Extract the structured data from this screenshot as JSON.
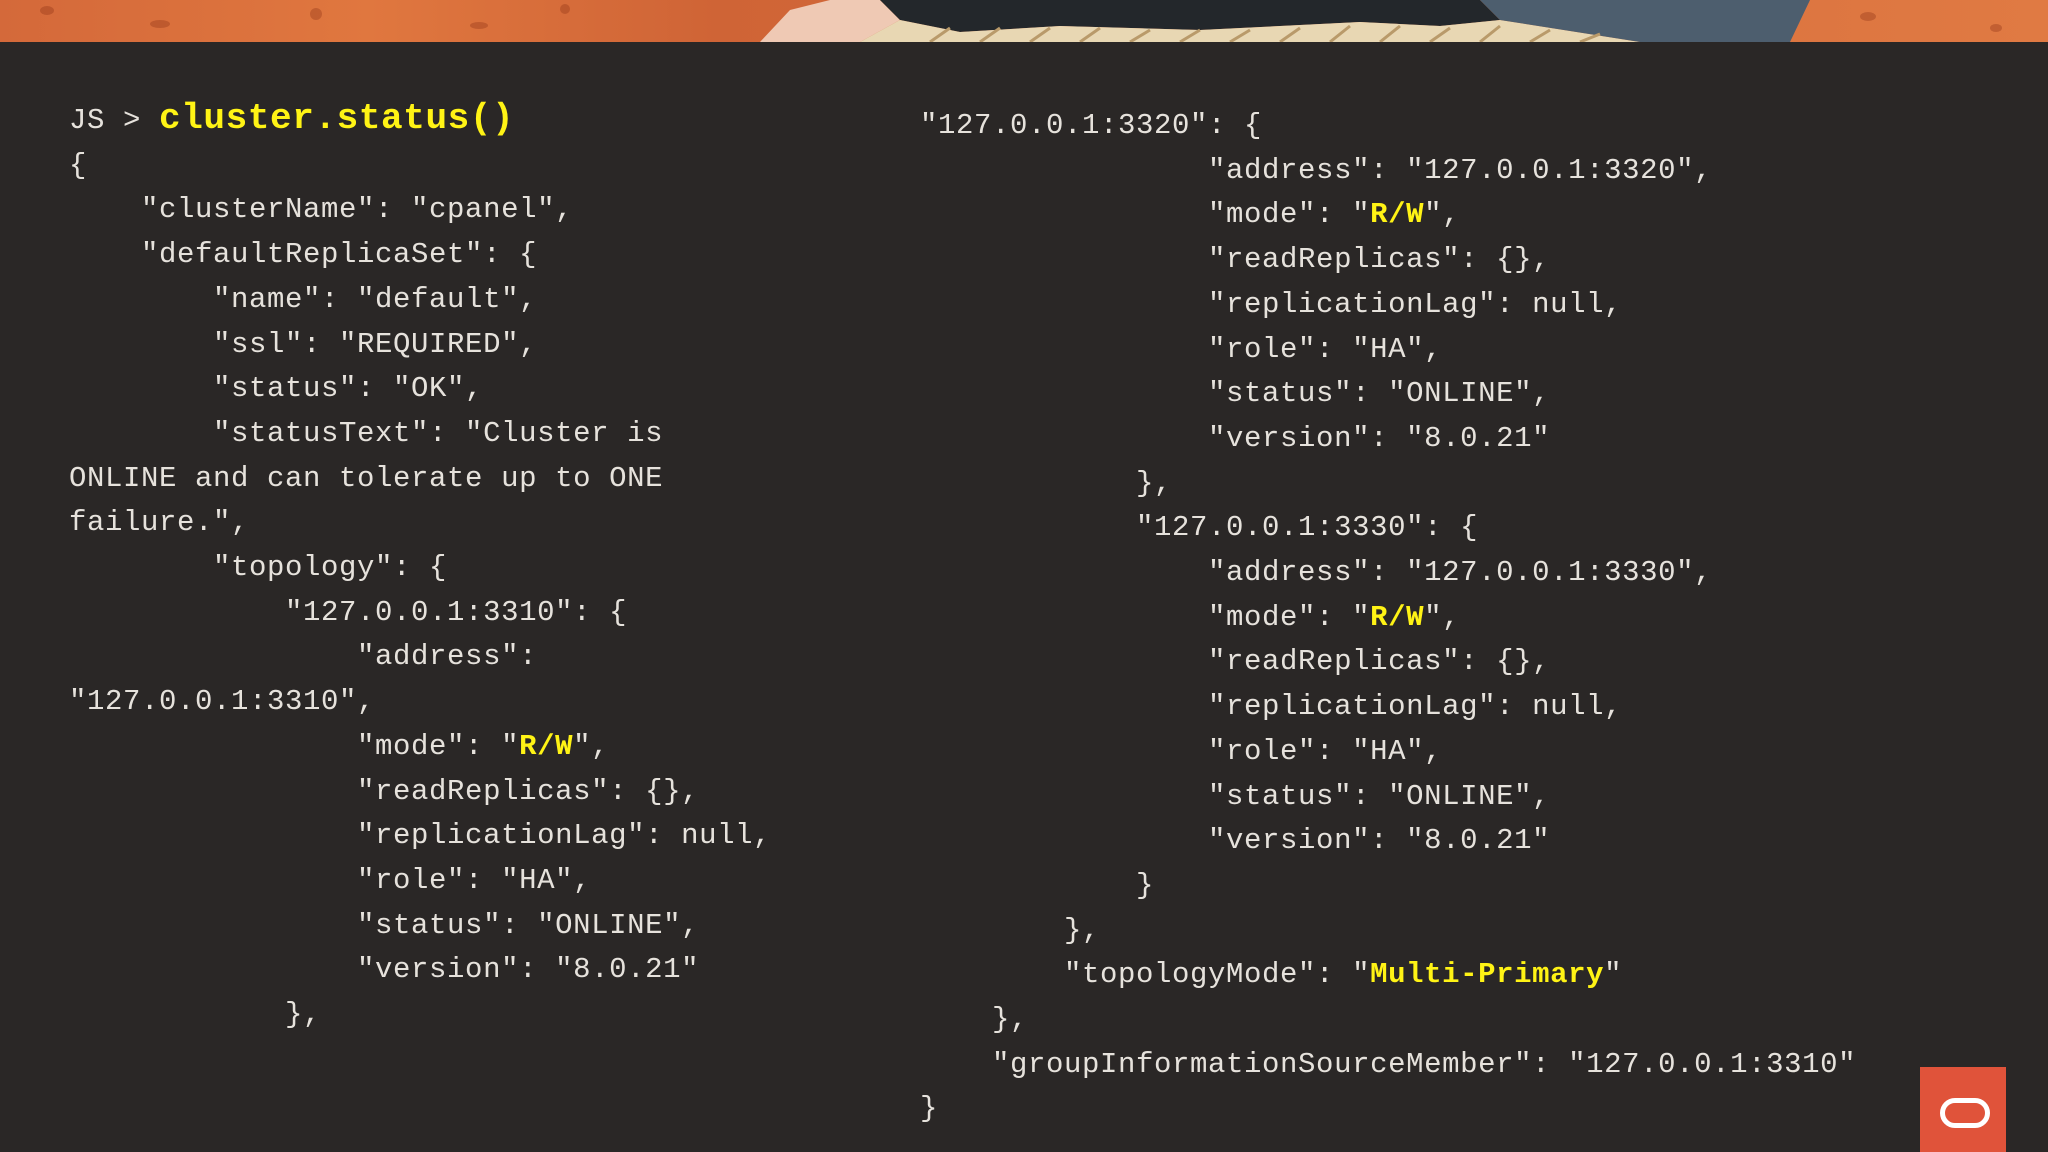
{
  "colors": {
    "background": "#2a2726",
    "code_text": "#e6e2dc",
    "highlight": "#fff315",
    "banner": "#e0773f",
    "badge": "#e0533a"
  },
  "prompt": {
    "prefix": "JS > ",
    "command": "cluster.status()"
  },
  "left_lines": [
    [
      {
        "t": "{"
      }
    ],
    [
      {
        "t": "    \"clusterName\": \"cpanel\","
      }
    ],
    [
      {
        "t": "    \"defaultReplicaSet\": {"
      }
    ],
    [
      {
        "t": "        \"name\": \"default\","
      }
    ],
    [
      {
        "t": "        \"ssl\": \"REQUIRED\","
      }
    ],
    [
      {
        "t": "        \"status\": \"OK\","
      }
    ],
    [
      {
        "t": "        \"statusText\": \"Cluster is"
      }
    ],
    [
      {
        "t": "ONLINE and can tolerate up to ONE"
      }
    ],
    [
      {
        "t": "failure.\","
      }
    ],
    [
      {
        "t": "        \"topology\": {"
      }
    ],
    [
      {
        "t": "            \"127.0.0.1:3310\": {"
      }
    ],
    [
      {
        "t": "                \"address\":"
      }
    ],
    [
      {
        "t": "\"127.0.0.1:3310\","
      }
    ],
    [
      {
        "t": "                \"mode\": \""
      },
      {
        "t": "R/W",
        "hl": true
      },
      {
        "t": "\","
      }
    ],
    [
      {
        "t": "                \"readReplicas\": {},"
      }
    ],
    [
      {
        "t": "                \"replicationLag\": null,"
      }
    ],
    [
      {
        "t": "                \"role\": \"HA\","
      }
    ],
    [
      {
        "t": "                \"status\": \"ONLINE\","
      }
    ],
    [
      {
        "t": "                \"version\": \"8.0.21\""
      }
    ],
    [
      {
        "t": "            },"
      }
    ]
  ],
  "right_lines": [
    [
      {
        "t": "\"127.0.0.1:3320\": {"
      }
    ],
    [
      {
        "t": "                \"address\": \"127.0.0.1:3320\","
      }
    ],
    [
      {
        "t": "                \"mode\": \""
      },
      {
        "t": "R/W",
        "hl": true
      },
      {
        "t": "\","
      }
    ],
    [
      {
        "t": "                \"readReplicas\": {},"
      }
    ],
    [
      {
        "t": "                \"replicationLag\": null,"
      }
    ],
    [
      {
        "t": "                \"role\": \"HA\","
      }
    ],
    [
      {
        "t": "                \"status\": \"ONLINE\","
      }
    ],
    [
      {
        "t": "                \"version\": \"8.0.21\""
      }
    ],
    [
      {
        "t": "            },"
      }
    ],
    [
      {
        "t": "            \"127.0.0.1:3330\": {"
      }
    ],
    [
      {
        "t": "                \"address\": \"127.0.0.1:3330\","
      }
    ],
    [
      {
        "t": "                \"mode\": \""
      },
      {
        "t": "R/W",
        "hl": true
      },
      {
        "t": "\","
      }
    ],
    [
      {
        "t": "                \"readReplicas\": {},"
      }
    ],
    [
      {
        "t": "                \"replicationLag\": null,"
      }
    ],
    [
      {
        "t": "                \"role\": \"HA\","
      }
    ],
    [
      {
        "t": "                \"status\": \"ONLINE\","
      }
    ],
    [
      {
        "t": "                \"version\": \"8.0.21\""
      }
    ],
    [
      {
        "t": "            }"
      }
    ],
    [
      {
        "t": "        },"
      }
    ],
    [
      {
        "t": "        \"topologyMode\": \""
      },
      {
        "t": "Multi-Primary",
        "hl": true
      },
      {
        "t": "\""
      }
    ],
    [
      {
        "t": "    },"
      }
    ],
    [
      {
        "t": "    \"groupInformationSourceMember\": \"127.0.0.1:3310\""
      }
    ],
    [
      {
        "t": "}"
      }
    ]
  ],
  "icons": {
    "badge": "oracle-logo-icon"
  }
}
